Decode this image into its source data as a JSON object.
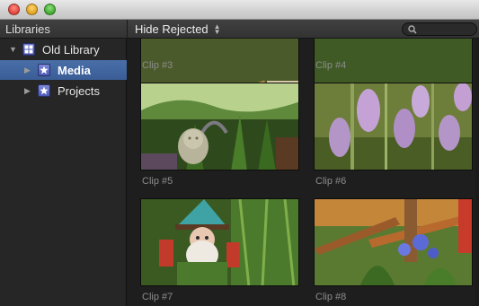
{
  "window": {
    "buttons": [
      "close-icon",
      "minimize-icon",
      "zoom-icon"
    ]
  },
  "toolbar": {
    "libraries_title": "Libraries",
    "filter_value": "Hide Rejected",
    "search_placeholder": ""
  },
  "sidebar": {
    "library": {
      "label": "Old Library",
      "icon": "library-icon",
      "expanded": true
    },
    "items": [
      {
        "label": "Media",
        "icon": "event-star-icon",
        "selected": true
      },
      {
        "label": "Projects",
        "icon": "event-star-icon",
        "selected": false
      }
    ]
  },
  "clips": [
    {
      "label": "Clip #3",
      "subject": "flowers"
    },
    {
      "label": "Clip #4",
      "subject": "foliage"
    },
    {
      "label": "Clip #5",
      "subject": "garden-statue"
    },
    {
      "label": "Clip #6",
      "subject": "purple-bells"
    },
    {
      "label": "Clip #7",
      "subject": "gnome"
    },
    {
      "label": "Clip #8",
      "subject": "blue-flowers"
    }
  ],
  "colors": {
    "selection": "#3a5d96",
    "background": "#1e1e1e",
    "sidebar": "#262626",
    "label": "#8c8c8c"
  }
}
